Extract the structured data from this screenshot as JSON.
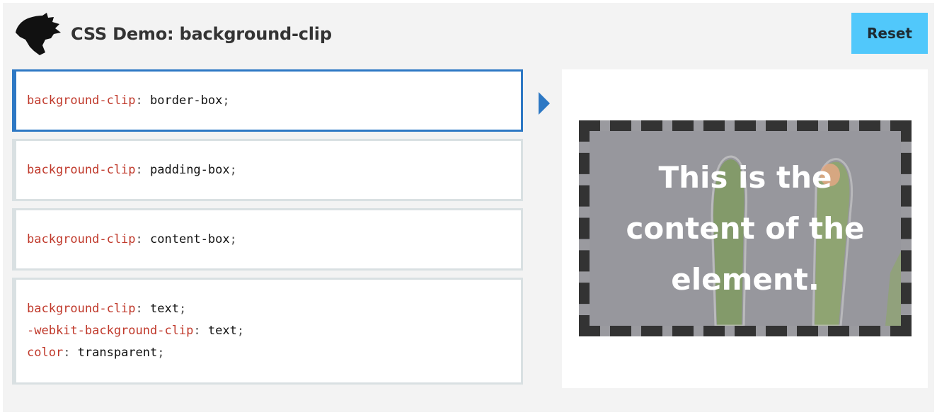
{
  "header": {
    "title": "CSS Demo: background-clip",
    "reset_label": "Reset",
    "logo_icon": "dinosaur-logo-icon"
  },
  "choices": [
    {
      "lines": [
        {
          "prop": "background-clip",
          "sep": ": ",
          "value": "border-box",
          "end": ";"
        }
      ]
    },
    {
      "lines": [
        {
          "prop": "background-clip",
          "sep": ": ",
          "value": "padding-box",
          "end": ";"
        }
      ]
    },
    {
      "lines": [
        {
          "prop": "background-clip",
          "sep": ": ",
          "value": "content-box",
          "end": ";"
        }
      ]
    },
    {
      "lines": [
        {
          "prop": "background-clip",
          "sep": ": ",
          "value": "text",
          "end": ";"
        },
        {
          "prop": "-webkit-background-clip",
          "sep": ": ",
          "value": "text",
          "end": ";"
        },
        {
          "prop": "color",
          "sep": ": ",
          "value": "transparent",
          "end": ";"
        }
      ]
    }
  ],
  "active_choice": 0,
  "output": {
    "example_text": "This is the content of the element."
  },
  "colors": {
    "accent": "#2d78c4",
    "reset_bg": "#51c8fb",
    "property": "#c0392b"
  }
}
